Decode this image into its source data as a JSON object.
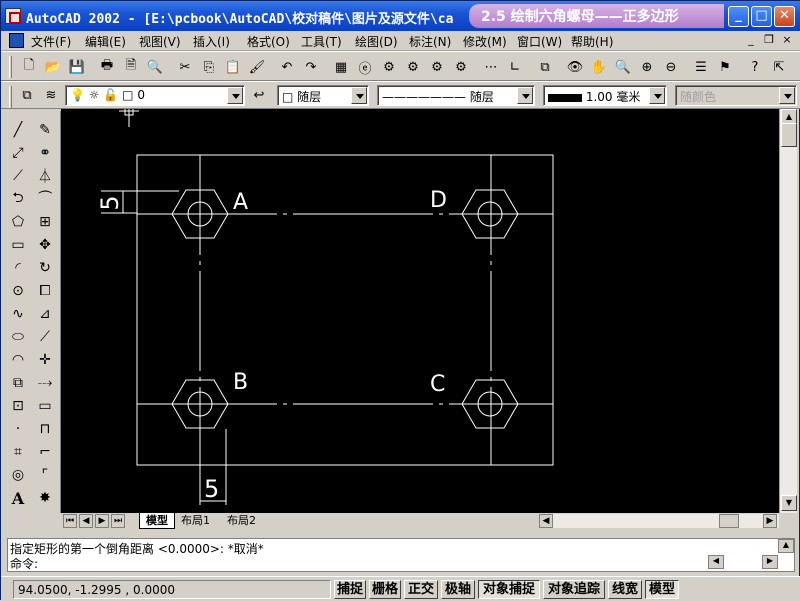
{
  "window": {
    "title": "AutoCAD 2002 - [E:\\pcbook\\AutoCAD\\校对稿件\\图片及源文件\\ca",
    "overlay_title": "2.5 绘制六角螺母——正多边形",
    "min_label": "_",
    "max_label": "□",
    "close_label": "✕"
  },
  "menu": {
    "items": [
      "文件(F)",
      "编辑(E)",
      "视图(V)",
      "插入(I)",
      "格式(O)",
      "工具(T)",
      "绘图(D)",
      "标注(N)",
      "修改(M)",
      "窗口(W)",
      "帮助(H)"
    ],
    "doc_min": "_",
    "doc_restore": "❐",
    "doc_close": "×"
  },
  "properties": {
    "layer_value": "0",
    "color_value": "□ 随层",
    "linetype_value": "———————  随层",
    "lineweight_value": "1.00 毫米",
    "plotstyle_value": "随颜色"
  },
  "drawing": {
    "label_a": "A",
    "label_b": "B",
    "label_c": "C",
    "label_d": "D",
    "dim_vertical": "5",
    "dim_horizontal": "5"
  },
  "layout_tabs": {
    "model": "模型",
    "layout1": "布局1",
    "layout2": "布局2"
  },
  "command": {
    "history_line": "指定矩形的第一个倒角距离 <0.0000>: *取消*",
    "prompt": "命令:"
  },
  "status": {
    "coords": "94.0500, -1.2995 , 0.0000",
    "snap": "捕捉",
    "grid": "栅格",
    "ortho": "正交",
    "polar": "极轴",
    "osnap": "对象捕捉",
    "otrack": "对象追踪",
    "lwt": "线宽",
    "model": "模型"
  },
  "colors": {
    "canvas_bg": "#000000",
    "geometry": "#ffffff",
    "title_gradient_top": "#3a7bea",
    "overlay_purple": "#b27ccc"
  }
}
